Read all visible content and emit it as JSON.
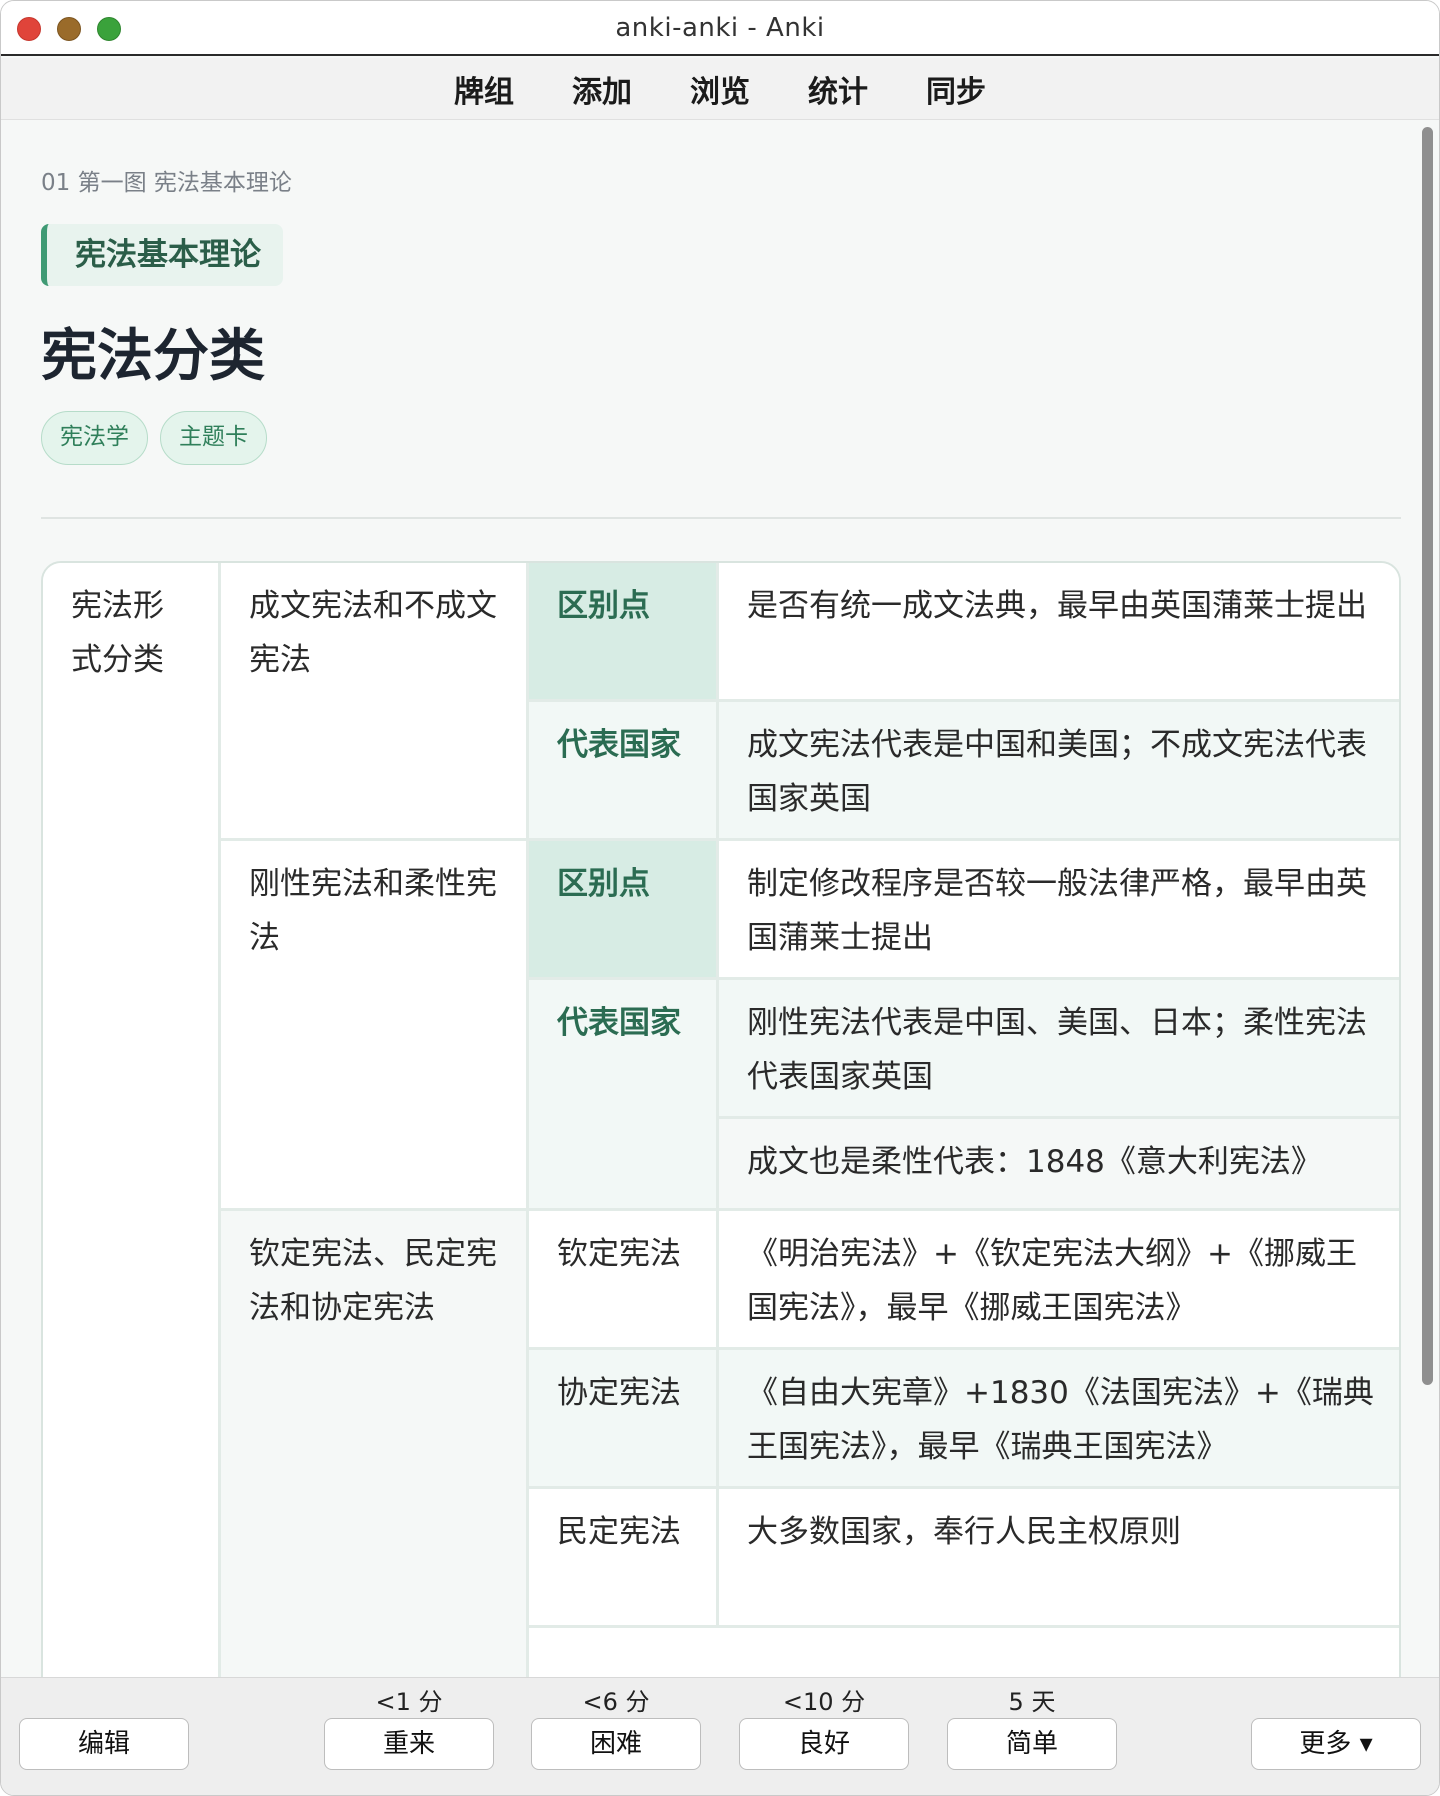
{
  "window": {
    "title": "anki-anki - Anki"
  },
  "topnav": {
    "items": [
      "牌组",
      "添加",
      "浏览",
      "统计",
      "同步"
    ]
  },
  "card": {
    "breadcrumb": "01 第一图 宪法基本理论",
    "section": "宪法基本理论",
    "title": "宪法分类",
    "tags": [
      "宪法学",
      "主题卡"
    ]
  },
  "table": {
    "r_category": "宪法形式分类",
    "g1_name": "成文宪法和不成文宪法",
    "g2_name": "刚性宪法和柔性宪法",
    "g3_name": "钦定宪法、民定宪法和协定宪法",
    "label_diff": "区别点",
    "label_country": "代表国家",
    "g1_diff": "是否有统一成文法典，最早由英国蒲莱士提出",
    "g1_country": "成文宪法代表是中国和美国；不成文宪法代表国家英国",
    "g2_diff": "制定修改程序是否较一般法律严格，最早由英国蒲莱士提出",
    "g2_country": "刚性宪法代表是中国、美国、日本；柔性宪法代表国家英国",
    "g2_extra": "成文也是柔性代表：1848《意大利宪法》",
    "g3_r1_label": "钦定宪法",
    "g3_r1_text": "《明治宪法》+《钦定宪法大纲》+《挪威王国宪法》，最早《挪威王国宪法》",
    "g3_r2_label": "协定宪法",
    "g3_r2_text": "《自由大宪章》+1830《法国宪法》+《瑞典王国宪法》，最早《瑞典王国宪法》",
    "g3_r3_label": "民定宪法",
    "g3_r3_text": "大多数国家，奉行人民主权原则"
  },
  "bottom": {
    "edit": "编辑",
    "again": "重来",
    "hard": "困难",
    "good": "良好",
    "easy": "简单",
    "more": "更多 ▾",
    "again_time": "<1 分",
    "hard_time": "<6 分",
    "good_time": "<10 分",
    "easy_time": "5 天"
  }
}
